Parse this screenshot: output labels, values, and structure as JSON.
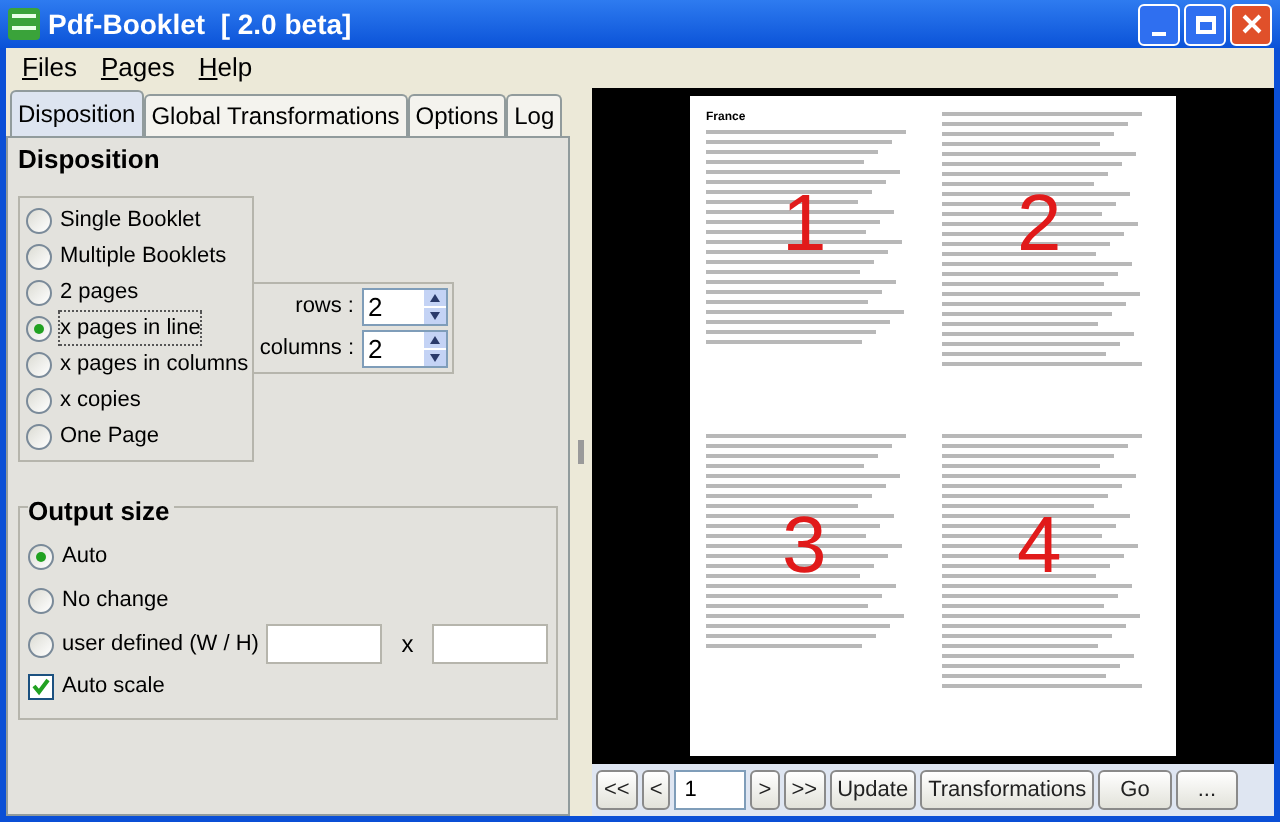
{
  "window": {
    "title": "Pdf-Booklet  [ 2.0 beta]"
  },
  "menu": [
    {
      "label": "Files"
    },
    {
      "label": "Pages"
    },
    {
      "label": "Help"
    }
  ],
  "tabs": [
    {
      "label": "Disposition",
      "selected": true
    },
    {
      "label": "Global Transformations",
      "selected": false
    },
    {
      "label": "Options",
      "selected": false
    },
    {
      "label": "Log",
      "selected": false
    }
  ],
  "disposition": {
    "title": "Disposition",
    "options": [
      {
        "label": "Single Booklet",
        "selected": false
      },
      {
        "label": "Multiple Booklets",
        "selected": false
      },
      {
        "label": "2 pages",
        "selected": false
      },
      {
        "label": "x pages in line",
        "selected": true
      },
      {
        "label": "x pages in columns",
        "selected": false
      },
      {
        "label": "x copies",
        "selected": false
      },
      {
        "label": "One Page",
        "selected": false
      }
    ],
    "spinners": [
      {
        "label": "rows :",
        "value": "2"
      },
      {
        "label": "columns :",
        "value": "2"
      }
    ]
  },
  "output_size": {
    "title": "Output size",
    "options": [
      {
        "label": "Auto",
        "selected": true
      },
      {
        "label": "No change",
        "selected": false
      },
      {
        "label": "user defined (W / H)",
        "selected": false
      }
    ],
    "separator": "x",
    "auto_scale": {
      "label": "Auto scale",
      "checked": true
    }
  },
  "preview": {
    "heading": "France",
    "pages": [
      {
        "number": "1"
      },
      {
        "number": "2"
      },
      {
        "number": "3"
      },
      {
        "number": "4"
      }
    ]
  },
  "toolbar": {
    "nav_before": [
      "<<",
      "<"
    ],
    "page": "1",
    "nav_after": [
      ">",
      ">>"
    ],
    "buttons": [
      "Update",
      "Transformations",
      "Go",
      "..."
    ]
  }
}
